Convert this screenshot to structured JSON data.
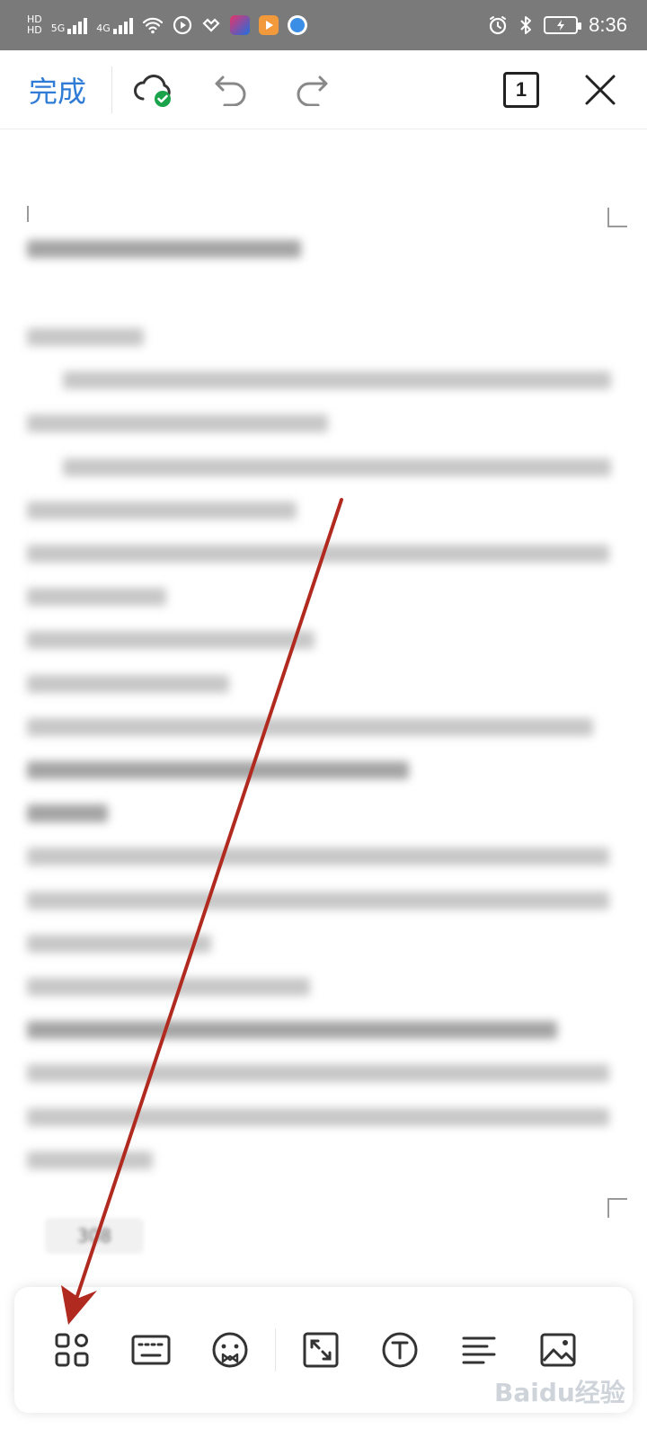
{
  "status_bar": {
    "network_1": "5G",
    "network_2": "4G",
    "time": "8:36"
  },
  "toolbar": {
    "done_label": "完成",
    "page_count": "1"
  },
  "document": {
    "page_indicator": "308"
  },
  "bottom_toolbar": {
    "items": [
      "apps-icon",
      "keyboard-icon",
      "emoji-icon",
      "fullscreen-icon",
      "text-format-icon",
      "paragraph-align-icon",
      "insert-image-icon"
    ]
  },
  "watermark": {
    "text": "Baidu经验"
  },
  "annotation": {
    "color": "#b02a20"
  }
}
